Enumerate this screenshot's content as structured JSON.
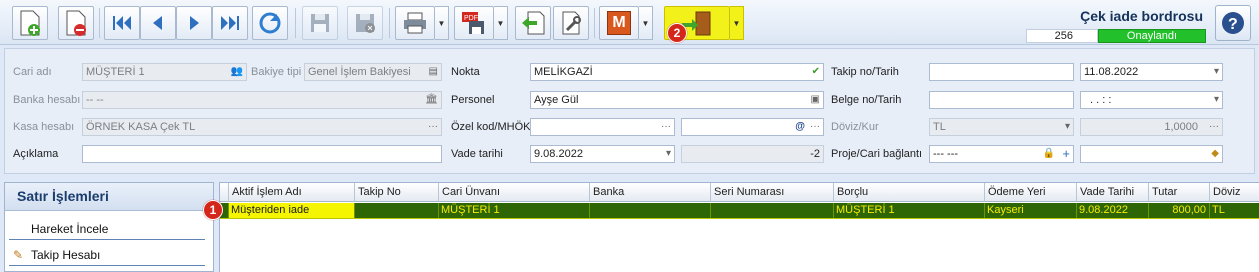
{
  "header": {
    "title": "Çek iade bordrosu",
    "doc_number": "256",
    "status": "Onaylandı",
    "status_color": "#22c02a"
  },
  "toolbar": {
    "icons": [
      "new-document-icon",
      "delete-document-icon",
      "first-record-icon",
      "previous-record-icon",
      "next-record-icon",
      "last-record-icon",
      "refresh-icon",
      "save-icon",
      "save-close-icon",
      "print-icon",
      "pdf-export-icon",
      "import-icon",
      "tools-icon",
      "m-module-icon",
      "exit-door-icon",
      "help-icon"
    ],
    "m_label": "M",
    "highlight_color": "#f2f21a"
  },
  "callouts": {
    "one": "1",
    "two": "2"
  },
  "form": {
    "cari_adi": {
      "label": "Cari adı",
      "value": "MÜŞTERİ 1"
    },
    "bakiye_tipi": {
      "label": "Bakiye tipi",
      "value": "Genel İşlem Bakiyesi"
    },
    "banka_hesabi": {
      "label": "Banka hesabı",
      "value": "-- --"
    },
    "kasa_hesabi": {
      "label": "Kasa hesabı",
      "value": "ÖRNEK KASA Çek TL"
    },
    "aciklama": {
      "label": "Açıklama",
      "value": ""
    },
    "nokta": {
      "label": "Nokta",
      "value": "MELİKGAZİ"
    },
    "personel": {
      "label": "Personel",
      "value": "Ayşe Gül"
    },
    "ozel_kod": {
      "label": "Özel kod/MHÖK",
      "value": ""
    },
    "vade_tarihi": {
      "label": "Vade tarihi",
      "value": "9.08.2022",
      "days": "-2"
    },
    "takip_no": {
      "label": "Takip no/Tarih",
      "value": "",
      "date": "11.08.2022"
    },
    "belge_no": {
      "label": "Belge no/Tarih",
      "value": "",
      "date": ".  .    :  :"
    },
    "doviz_kur": {
      "label": "Döviz/Kur",
      "currency": "TL",
      "rate": "1,0000"
    },
    "proje": {
      "label": "Proje/Cari bağlantı",
      "value": "--- ---",
      "value2": ""
    }
  },
  "panel": {
    "title": "Satır İşlemleri",
    "items": [
      "Hareket İncele",
      "Takip Hesabı"
    ]
  },
  "grid": {
    "columns": [
      "Aktif İşlem Adı",
      "Takip No",
      "Cari Ünvanı",
      "Banka",
      "Seri Numarası",
      "Borçlu",
      "Ödeme Yeri",
      "Vade Tarihi",
      "Tutar",
      "Döviz"
    ],
    "rows": [
      [
        "Müşteriden iade",
        "",
        "MÜŞTERİ 1",
        "",
        "",
        "MÜŞTERİ 1",
        "Kayseri",
        "9.08.2022",
        "800,00",
        "TL"
      ]
    ],
    "row_color": "#2e6606",
    "text_color": "#f7ec00"
  }
}
